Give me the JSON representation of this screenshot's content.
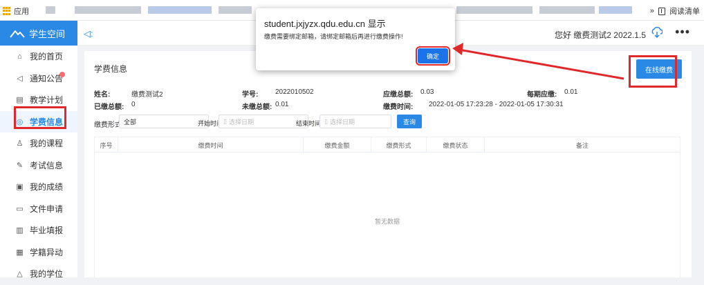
{
  "bookmarks": {
    "apps_label": "应用",
    "chevron": "»",
    "reading_list": "阅读清单"
  },
  "sidebar": {
    "logo_text": "学生空间",
    "items": [
      {
        "label": "我的首页",
        "icon": "home-icon"
      },
      {
        "label": "通知公告",
        "icon": "speaker-icon"
      },
      {
        "label": "教学计划",
        "icon": "plan-icon"
      },
      {
        "label": "学费信息",
        "icon": "fee-icon"
      },
      {
        "label": "我的课程",
        "icon": "person-icon"
      },
      {
        "label": "考试信息",
        "icon": "exam-icon"
      },
      {
        "label": "我的成绩",
        "icon": "score-icon"
      },
      {
        "label": "文件申请",
        "icon": "folder-icon"
      },
      {
        "label": "毕业填报",
        "icon": "form-icon"
      },
      {
        "label": "学籍异动",
        "icon": "record-icon"
      },
      {
        "label": "我的学位",
        "icon": "degree-icon"
      }
    ]
  },
  "header": {
    "greeting": "您好 缴费测试2 2022.1.5",
    "more": "•••"
  },
  "card": {
    "title": "学费信息",
    "pay_button": "在线缴费",
    "info": {
      "name_label": "姓名:",
      "name_value": "缴费测试2",
      "id_label": "学号:",
      "id_value": "2022010502",
      "due_label": "应缴总额:",
      "due_value": "0.03",
      "period_label": "每期应缴:",
      "period_value": "0.01",
      "paid_label": "已缴总额:",
      "paid_value": "0",
      "unpaid_label": "未缴总额:",
      "unpaid_value": "0.01",
      "time_label": "缴费时间:",
      "time_value": "2022-01-05 17:23:28 - 2022-01-05 17:30:31"
    },
    "filter": {
      "type_label": "缴费形式",
      "type_value": "全部",
      "start_label": "开始时间",
      "start_placeholder": "选择日期",
      "end_label": "结束时间",
      "end_placeholder": "选择日期",
      "query_button": "查询"
    },
    "table": {
      "columns": [
        "序号",
        "缴费时间",
        "缴费金额",
        "缴费形式",
        "缴费状态",
        "备注"
      ],
      "empty_text": "暂无数据"
    }
  },
  "dialog": {
    "host": "student.jxjyzx.qdu.edu.cn 显示",
    "message": "缴费需要绑定邮箱，请绑定邮箱后再进行缴费操作!",
    "ok_button": "确定"
  },
  "colors": {
    "accent": "#2b89e6",
    "highlight": "#e0282b",
    "dialog_button": "#1a73e8"
  }
}
